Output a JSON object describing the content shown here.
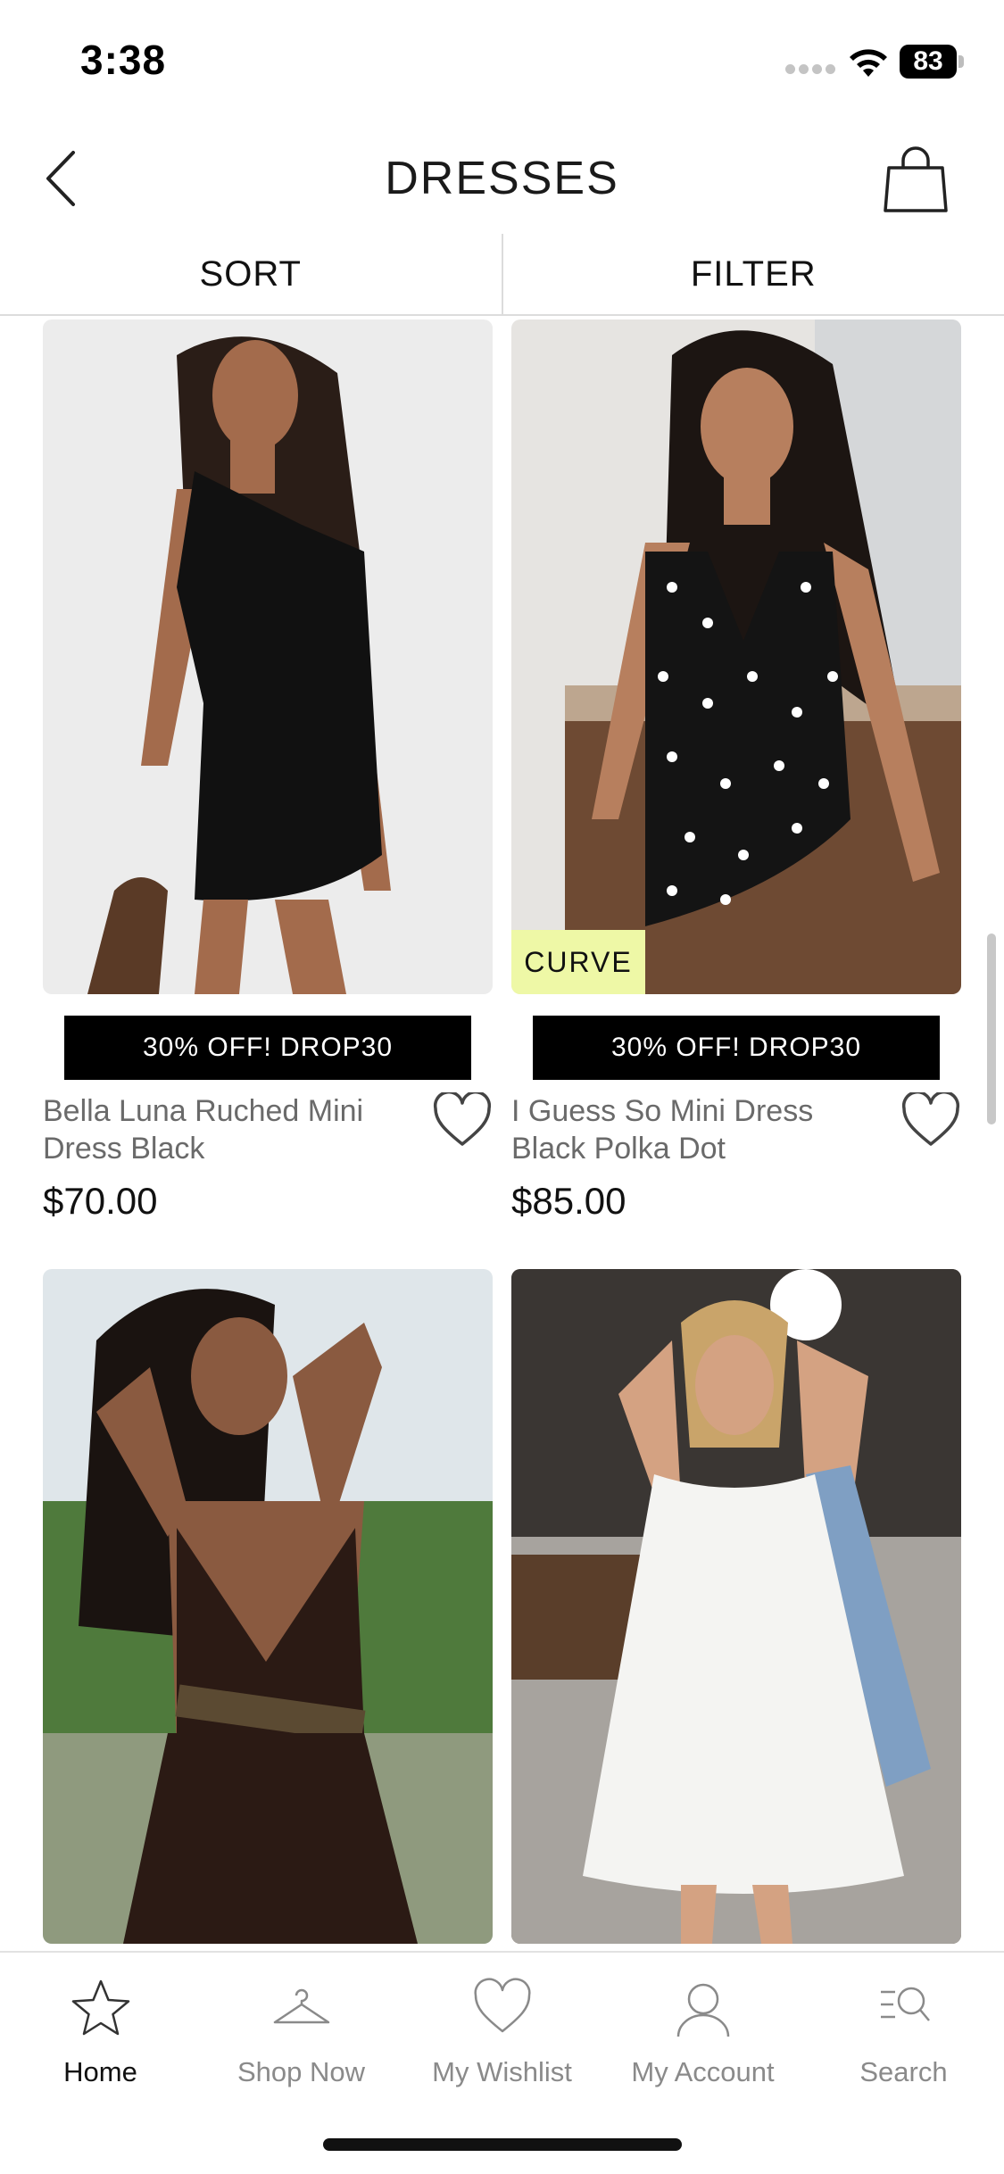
{
  "status_bar": {
    "time": "3:38",
    "battery": "83"
  },
  "header": {
    "title": "DRESSES"
  },
  "toolbar": {
    "sort_label": "SORT",
    "filter_label": "FILTER"
  },
  "products": [
    {
      "name": "Bella Luna Ruched Mini Dress Black",
      "price": "$70.00",
      "promo": "30% OFF! DROP30",
      "badge": "",
      "dress_color": "#111111"
    },
    {
      "name": "I Guess So Mini Dress Black Polka Dot",
      "price": "$85.00",
      "promo": "30% OFF! DROP30",
      "badge": "CURVE",
      "dress_color": "#141414"
    },
    {
      "name": "",
      "price": "",
      "promo": "",
      "badge": "",
      "dress_color": "#2b1a14"
    },
    {
      "name": "",
      "price": "",
      "promo": "",
      "badge": "",
      "dress_color": "#f4f4f2"
    }
  ],
  "tab_bar": {
    "tabs": [
      {
        "label": "Home",
        "icon": "star-icon"
      },
      {
        "label": "Shop Now",
        "icon": "hanger-icon"
      },
      {
        "label": "My Wishlist",
        "icon": "heart-icon"
      },
      {
        "label": "My Account",
        "icon": "person-icon"
      },
      {
        "label": "Search",
        "icon": "search-icon"
      }
    ]
  }
}
